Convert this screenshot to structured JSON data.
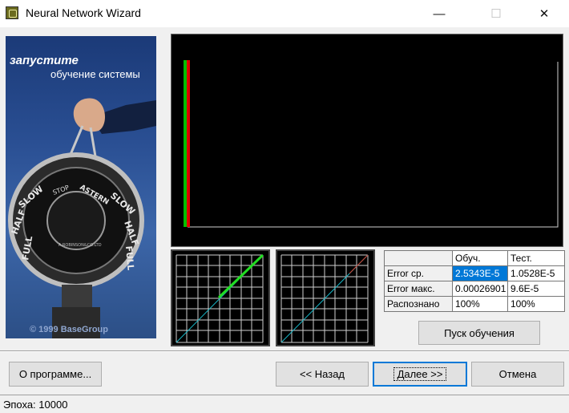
{
  "window": {
    "title": "Neural Network Wizard"
  },
  "side_panel": {
    "line1": "запустите",
    "line2": "обучение системы",
    "copyright": "© 1999 BaseGroup"
  },
  "colors": {
    "plot_bg": "#000000",
    "bar_green": "#00c000",
    "bar_red": "#e00000",
    "diag_cyan": "#18b8c8",
    "fit_green": "#22dd22",
    "selection": "#0078d7"
  },
  "results_table": {
    "headers": [
      "Обуч.",
      "Тест."
    ],
    "rows": [
      {
        "label": "Error ср.",
        "train": "2.5343E-5",
        "test": "1.0528E-5"
      },
      {
        "label": "Error макс.",
        "train": "0.00026901",
        "test": "9.6E-5"
      },
      {
        "label": "Распознано",
        "train": "100%",
        "test": "100%"
      }
    ]
  },
  "buttons": {
    "start_training": "Пуск обучения",
    "about": "О программе...",
    "back": "<< Назад",
    "next": "Далее >>",
    "cancel": "Отмена"
  },
  "status": {
    "epoch": "Эпоха: 10000"
  }
}
